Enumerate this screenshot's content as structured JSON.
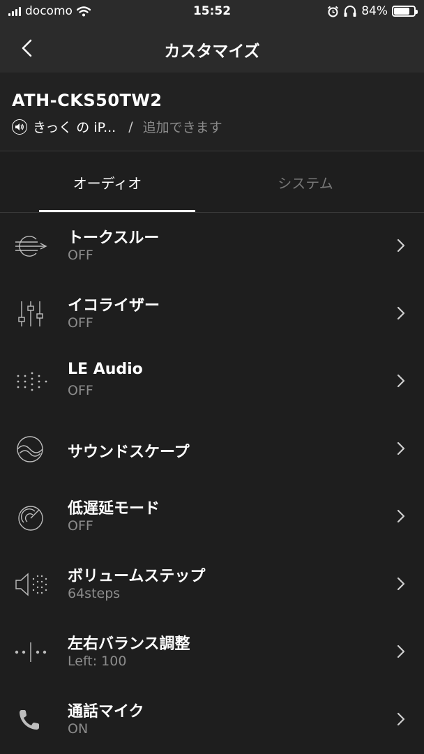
{
  "status_bar": {
    "carrier": "docomo",
    "time": "15:52",
    "battery_percent": "84%",
    "battery_level": 0.84
  },
  "nav": {
    "title": "カスタマイズ"
  },
  "device": {
    "name": "ATH-CKS50TW2",
    "connected_device": "きっく の iP...",
    "separator": "/",
    "add_text": "追加できます"
  },
  "tabs": [
    {
      "label": "オーディオ",
      "active": true
    },
    {
      "label": "システム",
      "active": false
    }
  ],
  "items": [
    {
      "title": "トークスルー",
      "status": "OFF",
      "icon": "talk-through-icon"
    },
    {
      "title": "イコライザー",
      "status": "OFF",
      "icon": "equalizer-icon"
    },
    {
      "title": "LE Audio",
      "status": "OFF",
      "icon": "le-audio-icon"
    },
    {
      "title": "サウンドスケープ",
      "status": "",
      "icon": "soundscape-icon"
    },
    {
      "title": "低遅延モード",
      "status": "OFF",
      "icon": "low-latency-icon"
    },
    {
      "title": "ボリュームステップ",
      "status": "64steps",
      "icon": "volume-step-icon"
    },
    {
      "title": "左右バランス調整",
      "status": "Left: 100",
      "icon": "balance-icon"
    },
    {
      "title": "通話マイク",
      "status": "ON",
      "icon": "phone-icon"
    }
  ]
}
